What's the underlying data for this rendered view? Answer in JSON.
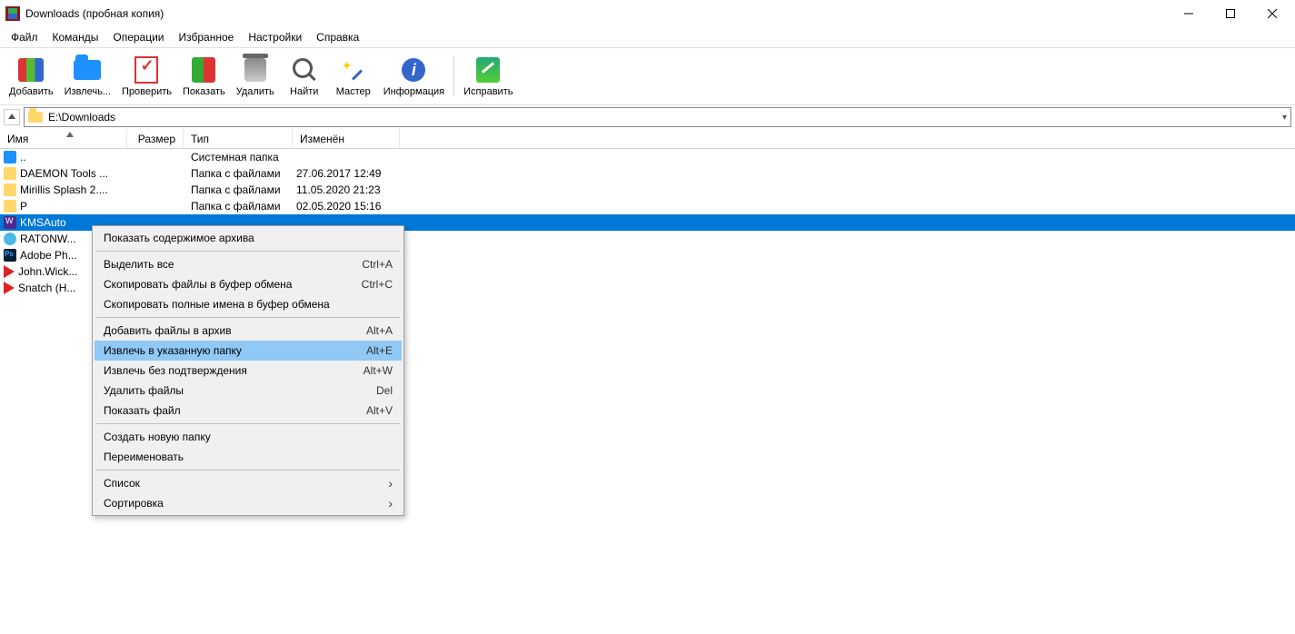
{
  "window": {
    "title": "Downloads (пробная копия)"
  },
  "menu": {
    "items": [
      "Файл",
      "Команды",
      "Операции",
      "Избранное",
      "Настройки",
      "Справка"
    ]
  },
  "toolbar": {
    "add": "Добавить",
    "extract": "Извлечь...",
    "test": "Проверить",
    "view": "Показать",
    "delete": "Удалить",
    "find": "Найти",
    "wizard": "Мастер",
    "info": "Информация",
    "repair": "Исправить"
  },
  "address": {
    "path": "E:\\Downloads"
  },
  "columns": {
    "name": "Имя",
    "size": "Размер",
    "type": "Тип",
    "modified": "Изменён"
  },
  "rows": [
    {
      "icon": "drive",
      "name": "..",
      "size": "",
      "type": "Системная папка",
      "date": ""
    },
    {
      "icon": "fold",
      "name": "DAEMON Tools ...",
      "size": "",
      "type": "Папка с файлами",
      "date": "27.06.2017 12:49"
    },
    {
      "icon": "fold",
      "name": "Mirillis Splash 2....",
      "size": "",
      "type": "Папка с файлами",
      "date": "11.05.2020 21:23"
    },
    {
      "icon": "fold",
      "name": "P",
      "size": "",
      "type": "Папка с файлами",
      "date": "02.05.2020 15:16"
    },
    {
      "icon": "arc",
      "name": "KMSAuto",
      "size": "",
      "type": "",
      "date": "",
      "selected": true
    },
    {
      "icon": "dmn",
      "name": "RATONW...",
      "size": "",
      "type": "",
      "date": ""
    },
    {
      "icon": "ps",
      "name": "Adobe Ph...",
      "size": "",
      "type": "",
      "date": ""
    },
    {
      "icon": "play",
      "name": "John.Wick...",
      "size": "",
      "type": "",
      "date": ""
    },
    {
      "icon": "play",
      "name": "Snatch (H...",
      "size": "",
      "type": "",
      "date": ""
    }
  ],
  "context_menu": {
    "items": [
      {
        "label": "Показать содержимое архива",
        "shortcut": ""
      },
      {
        "sep": true
      },
      {
        "label": "Выделить все",
        "shortcut": "Ctrl+A"
      },
      {
        "label": "Скопировать файлы в буфер обмена",
        "shortcut": "Ctrl+C"
      },
      {
        "label": "Скопировать полные имена в буфер обмена",
        "shortcut": ""
      },
      {
        "sep": true
      },
      {
        "label": "Добавить файлы в архив",
        "shortcut": "Alt+A"
      },
      {
        "label": "Извлечь в указанную папку",
        "shortcut": "Alt+E",
        "highlight": true
      },
      {
        "label": "Извлечь без подтверждения",
        "shortcut": "Alt+W"
      },
      {
        "label": "Удалить файлы",
        "shortcut": "Del"
      },
      {
        "label": "Показать файл",
        "shortcut": "Alt+V"
      },
      {
        "sep": true
      },
      {
        "label": "Создать новую папку",
        "shortcut": ""
      },
      {
        "label": "Переименовать",
        "shortcut": ""
      },
      {
        "sep": true
      },
      {
        "label": "Список",
        "sub": true
      },
      {
        "label": "Сортировка",
        "sub": true
      }
    ]
  }
}
